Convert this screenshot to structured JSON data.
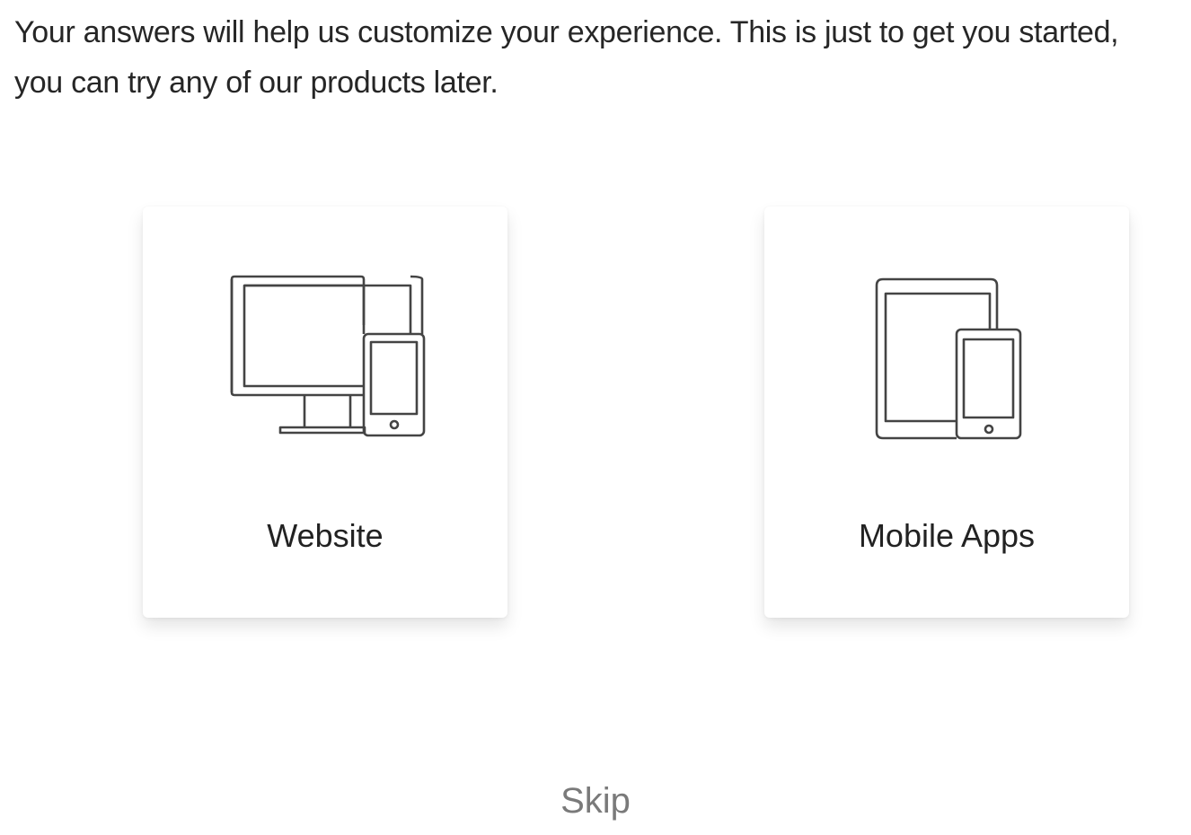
{
  "intro": {
    "line1": "Your answers will help us customize your experience. This is just to get you started,",
    "line2": "you can try any of our products later."
  },
  "options": {
    "website": {
      "label": "Website",
      "icon": "desktop-and-phone-icon"
    },
    "mobile": {
      "label": "Mobile Apps",
      "icon": "tablet-and-phone-icon"
    }
  },
  "skip_label": "Skip",
  "colors": {
    "text": "#222222",
    "muted": "#7a7a7a",
    "icon_stroke": "#444444",
    "background": "#ffffff"
  }
}
